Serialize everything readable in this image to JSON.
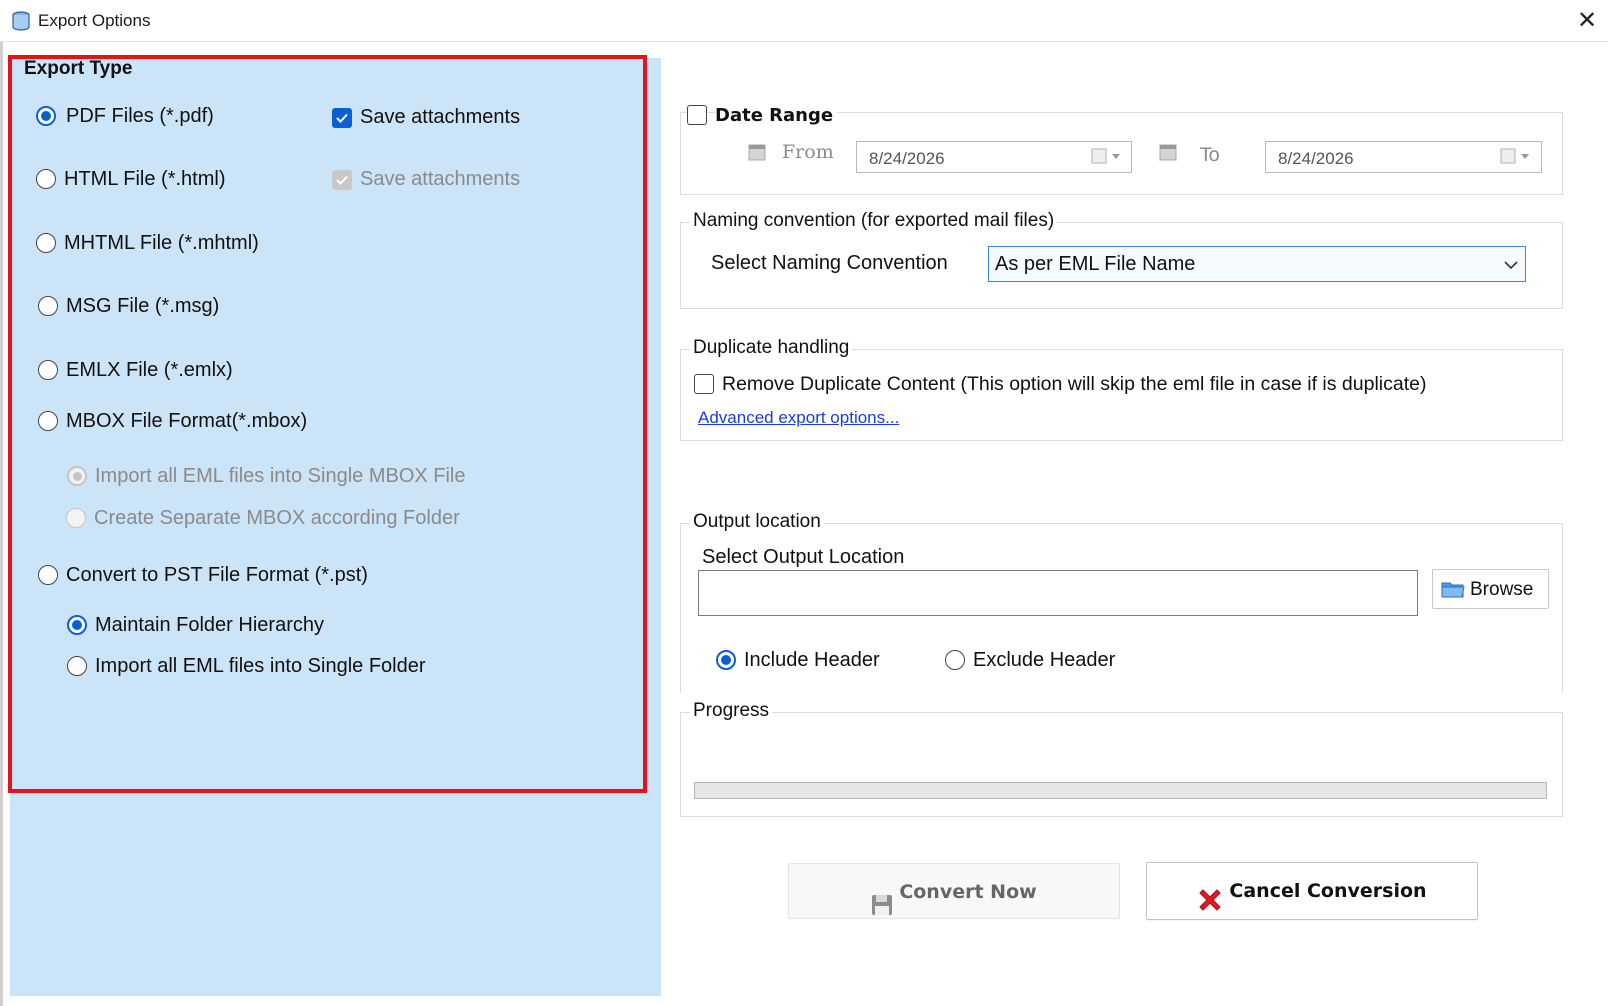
{
  "window": {
    "title": "Export Options",
    "close_glyph": "✕"
  },
  "export_type": {
    "title": "Export Type",
    "options": [
      {
        "label": "PDF Files (*.pdf)",
        "selected": true
      },
      {
        "label": "HTML File  (*.html)",
        "selected": false
      },
      {
        "label": "MHTML File  (*.mhtml)",
        "selected": false
      },
      {
        "label": "MSG File (*.msg)",
        "selected": false
      },
      {
        "label": "EMLX File (*.emlx)",
        "selected": false
      },
      {
        "label": "MBOX File Format(*.mbox)",
        "selected": false
      },
      {
        "label": "Convert to PST File Format (*.pst)",
        "selected": false
      }
    ],
    "pdf_save_attachments": {
      "label": "Save attachments",
      "checked": true
    },
    "html_save_attachments": {
      "label": "Save attachments",
      "checked": true,
      "disabled": true
    },
    "mbox_suboptions": [
      {
        "label": "Import all EML files into Single MBOX File",
        "selected": true,
        "disabled": true
      },
      {
        "label": "Create Separate MBOX according Folder",
        "selected": false,
        "disabled": true
      }
    ],
    "pst_suboptions": [
      {
        "label": "Maintain Folder Hierarchy",
        "selected": true
      },
      {
        "label": "Import all EML files into Single Folder",
        "selected": false
      }
    ]
  },
  "date_range": {
    "label": "Date Range",
    "checked": false,
    "from_label": "From",
    "from_value": "8/24/2026",
    "to_label": "To",
    "to_value": "8/24/2026"
  },
  "naming": {
    "legend": "Naming convention (for exported mail files)",
    "label": "Select Naming Convention",
    "selected": "As per EML File Name"
  },
  "duplicate": {
    "legend": "Duplicate handling",
    "checkbox_label": "Remove Duplicate Content (This option will skip the eml file in case if is duplicate)",
    "checked": false,
    "advanced_link": "Advanced export options..."
  },
  "output": {
    "legend": "Output location",
    "label": "Select Output Location",
    "path_value": "",
    "browse_label": "Browse",
    "header_options": [
      {
        "label": "Include Header",
        "selected": true
      },
      {
        "label": "Exclude Header",
        "selected": false
      }
    ]
  },
  "progress": {
    "legend": "Progress",
    "value": 0
  },
  "actions": {
    "convert_label": "Convert Now",
    "convert_enabled": false,
    "cancel_label": "Cancel Conversion"
  },
  "colors": {
    "panel_bg": "#cce4f7",
    "highlight_border": "#e0141e",
    "accent": "#0a5fd4",
    "link": "#1a3dd8"
  }
}
